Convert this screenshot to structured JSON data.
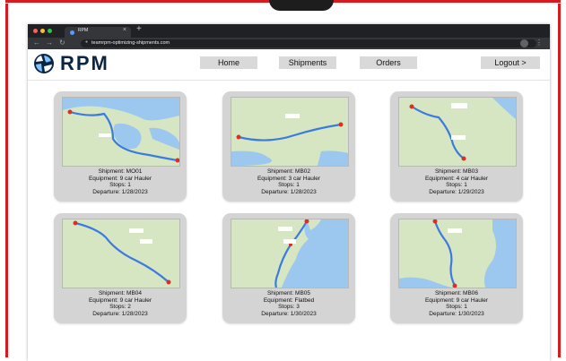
{
  "browser": {
    "tab_title": "RPM",
    "url": "teamrpm-optimizing-shipments.com"
  },
  "nav": {
    "logo_text": "RPM",
    "home": "Home",
    "shipments": "Shipments",
    "orders": "Orders",
    "logout": "Logout >"
  },
  "cards": [
    {
      "shipment": "Shipment: MO01",
      "equipment": "Equipment: 9 car Hauler",
      "stops": "Stops: 1",
      "departure": "Departure: 1/28/2023"
    },
    {
      "shipment": "Shipment: MB02",
      "equipment": "Equipment: 3 car Hauler",
      "stops": "Stops: 1",
      "departure": "Departure: 1/28/2023"
    },
    {
      "shipment": "Shipment: MB03",
      "equipment": "Equipment: 4 car Hauler",
      "stops": "Stops: 1",
      "departure": "Departure: 1/29/2023"
    },
    {
      "shipment": "Shipment: MB04",
      "equipment": "Equipment: 9 car Hauler",
      "stops": "Stops: 2",
      "departure": "Departure: 1/28/2023"
    },
    {
      "shipment": "Shipment: MB05",
      "equipment": "Equipment: Flatbed",
      "stops": "Stops: 3",
      "departure": "Departure: 1/30/2023"
    },
    {
      "shipment": "Shipment: MB06",
      "equipment": "Equipment: 9 car Hauler",
      "stops": "Stops: 1",
      "departure": "Departure: 1/30/2023"
    }
  ],
  "colors": {
    "frame_red": "#d71920",
    "map_land": "#d6e6c3",
    "map_water": "#9cc7ee",
    "route": "#3b7be0",
    "card": "#d4d4d4",
    "nav_button": "#d9d9d9"
  }
}
